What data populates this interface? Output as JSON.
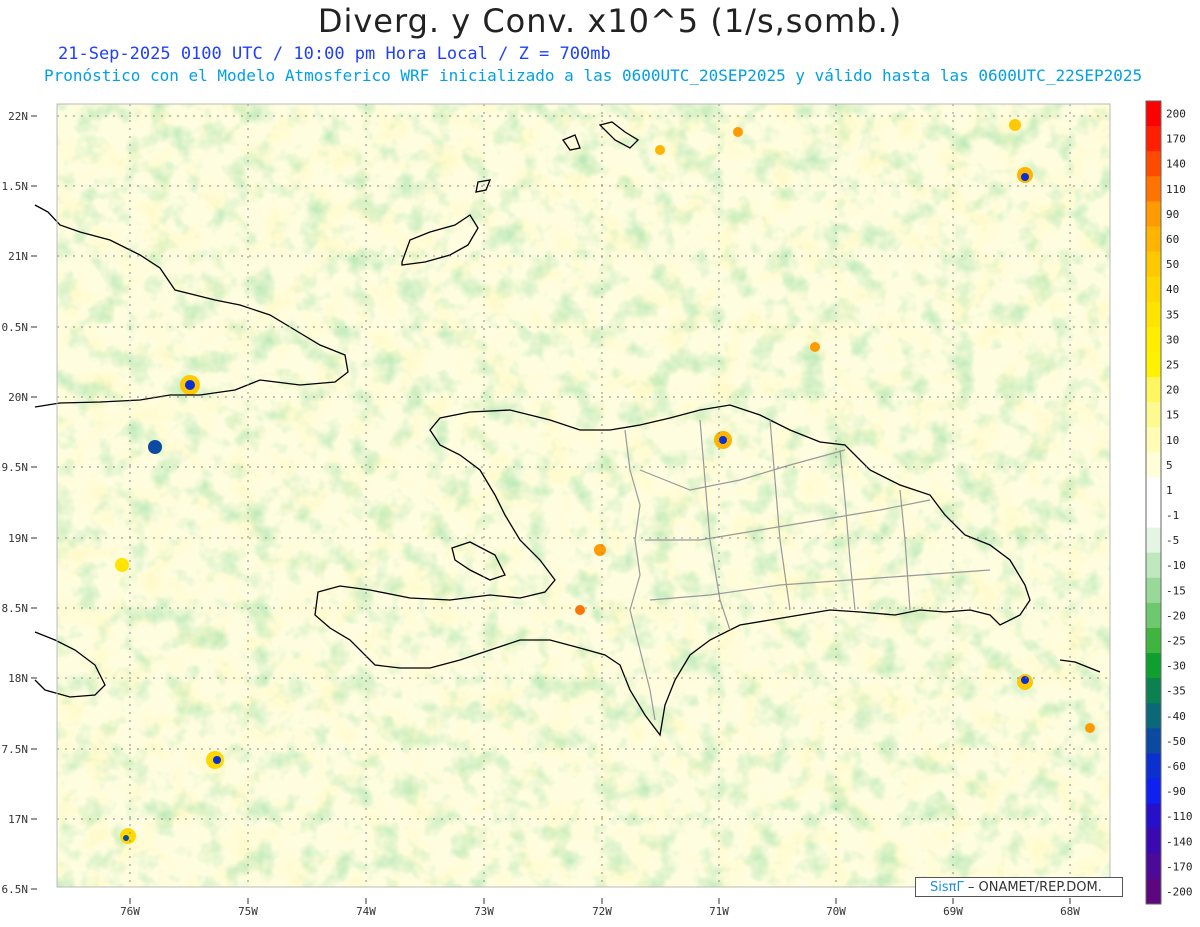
{
  "header": {
    "title": "Diverg. y Conv. x10^5 (1/s,somb.)",
    "subtitle_line1": "21-Sep-2025 0100 UTC / 10:00 pm Hora Local / Z = 700mb",
    "subtitle_line2": "Pronóstico con el Modelo Atmosferico WRF inicializado a las 0600UTC_20SEP2025 y válido hasta las  0600UTC_22SEP2025"
  },
  "axes": {
    "lat_labels": [
      "22N",
      "1.5N",
      "21N",
      "0.5N",
      "20N",
      "9.5N",
      "19N",
      "8.5N",
      "18N",
      "7.5N",
      "17N",
      "6.5N"
    ],
    "lon_labels": [
      "76W",
      "75W",
      "74W",
      "73W",
      "72W",
      "71W",
      "70W",
      "69W",
      "68W"
    ]
  },
  "colorbar": {
    "labels": [
      "200",
      "170",
      "140",
      "110",
      "90",
      "60",
      "50",
      "40",
      "35",
      "30",
      "25",
      "20",
      "15",
      "10",
      "5",
      "1",
      "-1",
      "-5",
      "-10",
      "-15",
      "-20",
      "-25",
      "-30",
      "-35",
      "-40",
      "-50",
      "-60",
      "-90",
      "-110",
      "-140",
      "-170",
      "-200"
    ],
    "colors": [
      "#ff0000",
      "#ff2000",
      "#ff4a00",
      "#ff7400",
      "#ff9a00",
      "#ffb400",
      "#ffc800",
      "#ffd800",
      "#ffe400",
      "#ffee00",
      "#fff200",
      "#fff660",
      "#fffa90",
      "#fffcb8",
      "#fffed8",
      "#ffffff",
      "#ffffff",
      "#e4f5e4",
      "#bfe8bf",
      "#98d898",
      "#6ec86e",
      "#3fb43f",
      "#0f9f2f",
      "#0b8050",
      "#0a6878",
      "#0a4aa0",
      "#0a30d0",
      "#1020f0",
      "#2810c8",
      "#3a0ab0",
      "#4c0a98",
      "#5c0680"
    ]
  },
  "credit": {
    "logo_text": "SisπΓ",
    "text": "– ONAMET/REP.DOM."
  }
}
